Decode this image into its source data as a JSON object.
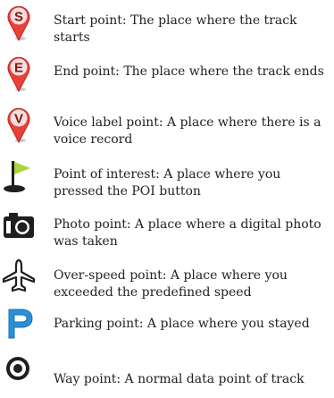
{
  "legend": {
    "items": [
      {
        "icon": "start-point-icon",
        "text": "Start point: The place where the track starts"
      },
      {
        "icon": "end-point-icon",
        "text": "End point: The place where the track ends"
      },
      {
        "icon": "voice-label-point-icon",
        "text": "Voice label point: A place where there is a voice record"
      },
      {
        "icon": "point-of-interest-flag-icon",
        "text": "Point of interest: A place where you pressed the POI button"
      },
      {
        "icon": "camera-photo-point-icon",
        "text": "Photo point: A place where a digital photo was taken"
      },
      {
        "icon": "airplane-over-speed-icon",
        "text": "Over-speed point: A place where you exceeded the predefined speed"
      },
      {
        "icon": "parking-p-icon",
        "text": "Parking point: A place where you stayed"
      },
      {
        "icon": "way-point-target-icon",
        "text": "Way point: A normal data point of track"
      }
    ],
    "pin_letters": [
      "S",
      "E",
      "V"
    ],
    "colors": {
      "pin_fill": "#e8413a",
      "pin_letter": "#7a1a12",
      "flag": "#a8d63c",
      "parking": "#2a8fd8",
      "icon_dark": "#1f1f1f"
    }
  }
}
